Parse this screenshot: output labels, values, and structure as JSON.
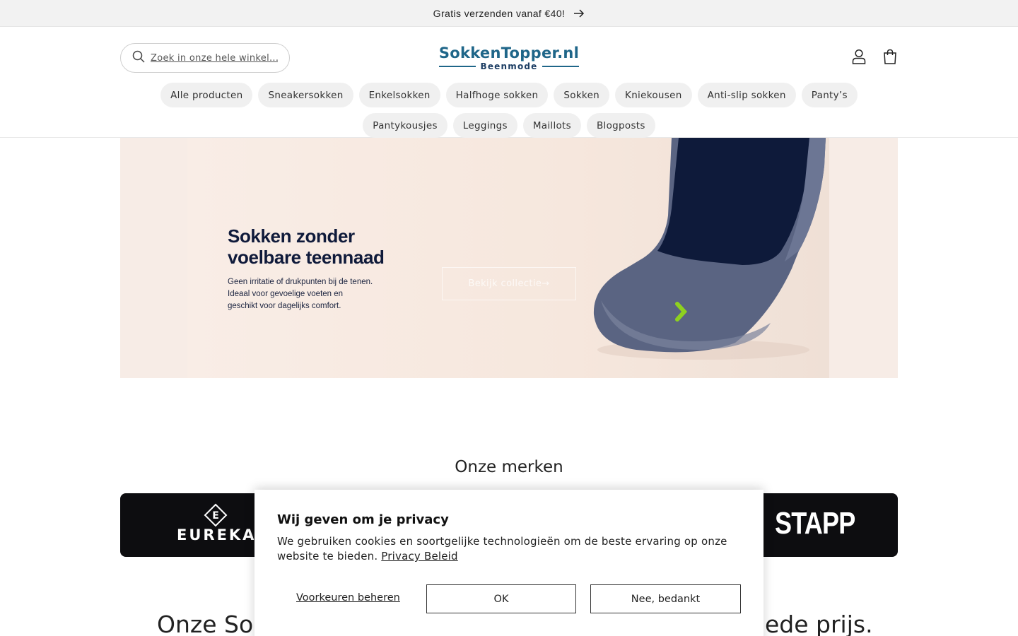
{
  "announcement": {
    "text": "Gratis verzenden vanaf €40!",
    "icon": "arrow-right-icon"
  },
  "header": {
    "search_placeholder": "Zoek in onze hele winkel...",
    "logo_main": "SokkenTopper.nl",
    "logo_sub": "Beenmode",
    "account_icon": "user-icon",
    "cart_icon": "bag-icon"
  },
  "nav": {
    "items": [
      {
        "label": "Alle producten"
      },
      {
        "label": "Sneakersokken"
      },
      {
        "label": "Enkelsokken"
      },
      {
        "label": "Halfhoge sokken"
      },
      {
        "label": "Sokken"
      },
      {
        "label": "Kniekousen"
      },
      {
        "label": "Anti-slip sokken"
      },
      {
        "label": "Panty’s"
      },
      {
        "label": "Pantykousjes"
      },
      {
        "label": "Leggings"
      },
      {
        "label": "Maillots"
      },
      {
        "label": "Blogposts"
      }
    ]
  },
  "hero": {
    "headline": "Sokken zonder\nvoelbare teennaad",
    "body": "Geen irritatie of drukpunten bij de tenen.\nIdeaal voor gevoelige voeten en\ngeschikt voor dagelijks comfort.",
    "cta": "Bekijk collectie→"
  },
  "brands": {
    "title": "Onze merken",
    "left_brand": "EUREKA",
    "right_brand": "STAPP"
  },
  "bottom_heading": {
    "left": "Onze Sok",
    "right": "ede prijs."
  },
  "cookie": {
    "title": "Wij geven om je privacy",
    "message": "We gebruiken cookies en soortgelijke technologieën om de beste ervaring op onze website te bieden.",
    "link": "Privacy Beleid",
    "preferences": "Voorkeuren beheren",
    "ok": "OK",
    "decline": "Nee, bedankt"
  },
  "colors": {
    "brand_blue": "#1f6689",
    "hero_bg": "#f7ece6",
    "sock_navy": "#0e1a3a",
    "accent_green": "#8ed11f"
  }
}
